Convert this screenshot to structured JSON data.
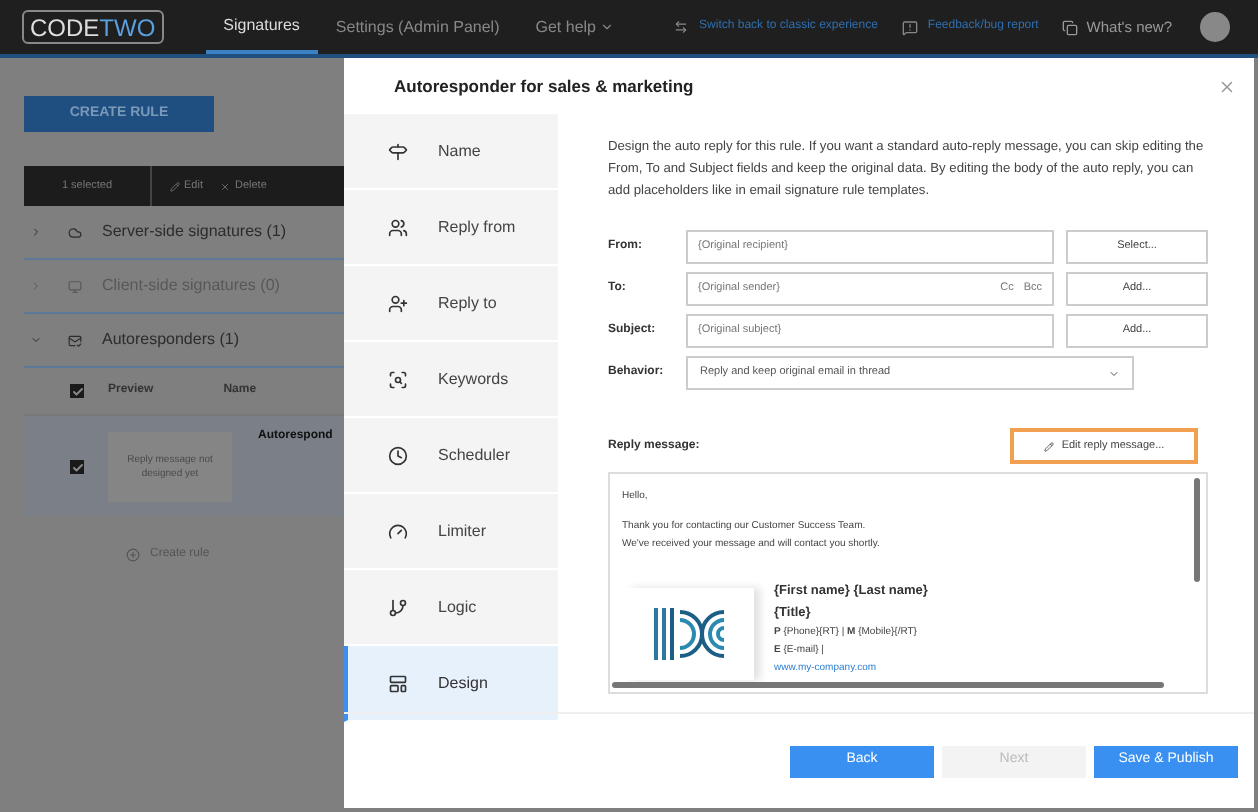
{
  "topbar": {
    "logo": [
      "CODE",
      "TWO"
    ],
    "tabs": [
      {
        "label": "Signatures",
        "selected": true,
        "caret": false
      },
      {
        "label": "Settings (Admin Panel)",
        "selected": false,
        "caret": false
      },
      {
        "label": "Get help",
        "selected": false,
        "caret": true
      }
    ],
    "switch_link": "Switch back to classic experience",
    "feedback_link": "Feedback/bug report",
    "whats_new": "What's new?"
  },
  "background": {
    "create_button": "CREATE RULE",
    "toolbar": {
      "count": "1 selected",
      "actions": [
        "Edit",
        "Delete"
      ]
    },
    "groups": [
      {
        "label": "Server-side signatures (1)",
        "expanded": false,
        "disabled": false
      },
      {
        "label": "Client-side signatures (0)",
        "expanded": false,
        "disabled": true
      },
      {
        "label": "Autoresponders (1)",
        "expanded": true,
        "disabled": false
      }
    ],
    "header_checked": true,
    "columns": [
      "Preview",
      "Name"
    ],
    "rows": [
      {
        "checked": true,
        "preview": "Reply message not designed yet",
        "name": "Autorespond"
      }
    ],
    "create_rule": "Create rule"
  },
  "modal": {
    "title": "Autoresponder for sales & marketing",
    "nav": [
      {
        "label": "Name",
        "selected": false
      },
      {
        "label": "Reply from",
        "selected": false
      },
      {
        "label": "Reply to",
        "selected": false
      },
      {
        "label": "Keywords",
        "selected": false
      },
      {
        "label": "Scheduler",
        "selected": false
      },
      {
        "label": "Limiter",
        "selected": false
      },
      {
        "label": "Logic",
        "selected": false
      },
      {
        "label": "Design",
        "selected": true
      }
    ],
    "description": "Design the auto reply for this rule. If you want a standard auto-reply message, you can skip editing the From, To and Subject fields and keep the original data. By editing the body of the auto reply, you can add placeholders like in email signature rule templates.",
    "fields": [
      {
        "label": "From:",
        "placeholder": "{Original recipient}",
        "button": "Select..."
      },
      {
        "label": "To:",
        "placeholder": "{Original sender}",
        "extras": [
          "Cc",
          "Bcc"
        ],
        "button": "Add..."
      },
      {
        "label": "Subject:",
        "placeholder": "{Original subject}",
        "button": "Add..."
      }
    ],
    "behavior": {
      "label": "Behavior:",
      "value": "Reply and keep original email in thread"
    },
    "reply_label": "Reply message:",
    "edit_button": "Edit reply message...",
    "message": {
      "greeting": "Hello,",
      "lines": [
        "Thank you for contacting our Customer Success Team.",
        "We've received your message and will contact you shortly."
      ],
      "signature": {
        "name": "{First name} {Last name}",
        "title": "{Title}",
        "phone": "**P** {Phone}{RT} | **M** {Mobile}{/RT}",
        "email": "**E** {E-mail} |",
        "website": "www.my-company.com"
      }
    },
    "footer": [
      {
        "label": "Back",
        "disabled": false
      },
      {
        "label": "Next",
        "disabled": true
      },
      {
        "label": "Save & Publish",
        "disabled": false
      }
    ]
  }
}
